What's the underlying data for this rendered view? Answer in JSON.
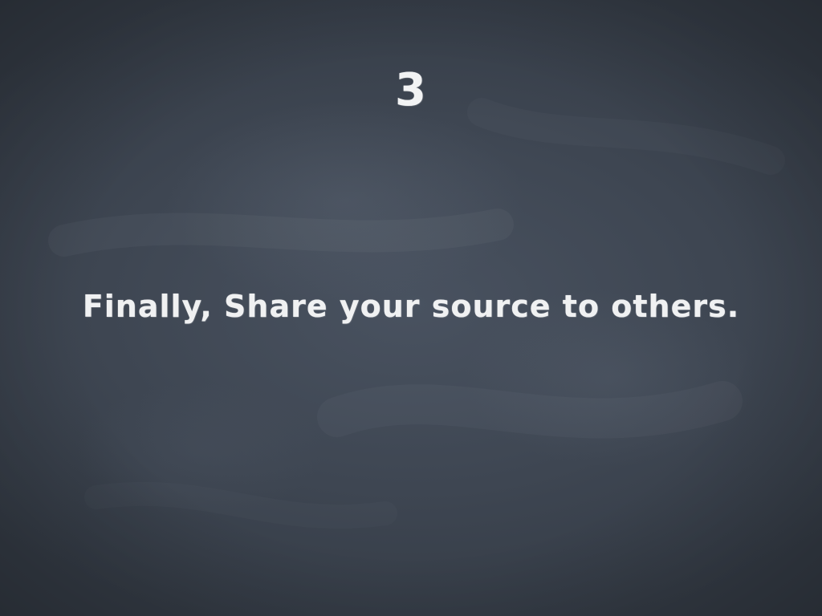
{
  "slide": {
    "number": "3",
    "body": "Finally, Share your source to others."
  },
  "theme": {
    "background_color": "#3a414c",
    "text_color": "#f0f1f2",
    "style": "chalkboard"
  }
}
